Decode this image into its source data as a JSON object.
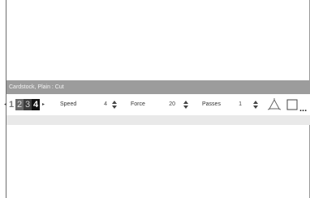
{
  "window": {
    "title": "Cardstock, Plain : Cut"
  },
  "toolbar": {
    "tool_numbers": [
      "1",
      "2",
      "3",
      "4"
    ],
    "speed": {
      "label": "Speed",
      "value": "4"
    },
    "force": {
      "label": "Force",
      "value": "20"
    },
    "passes": {
      "label": "Passes",
      "value": "1"
    },
    "more_label": "..."
  },
  "icons": {
    "left_arrow": "triangle-left-icon",
    "right_arrow": "triangle-right-icon",
    "steppers": "up-down-stepper-icon",
    "triangle": "triangle-outline-icon",
    "square": "square-outline-icon"
  },
  "colors": {
    "titlebar": "#9c9c9c",
    "toolbar_bottom": "#e9e9e9",
    "tool_active": "#111111"
  }
}
